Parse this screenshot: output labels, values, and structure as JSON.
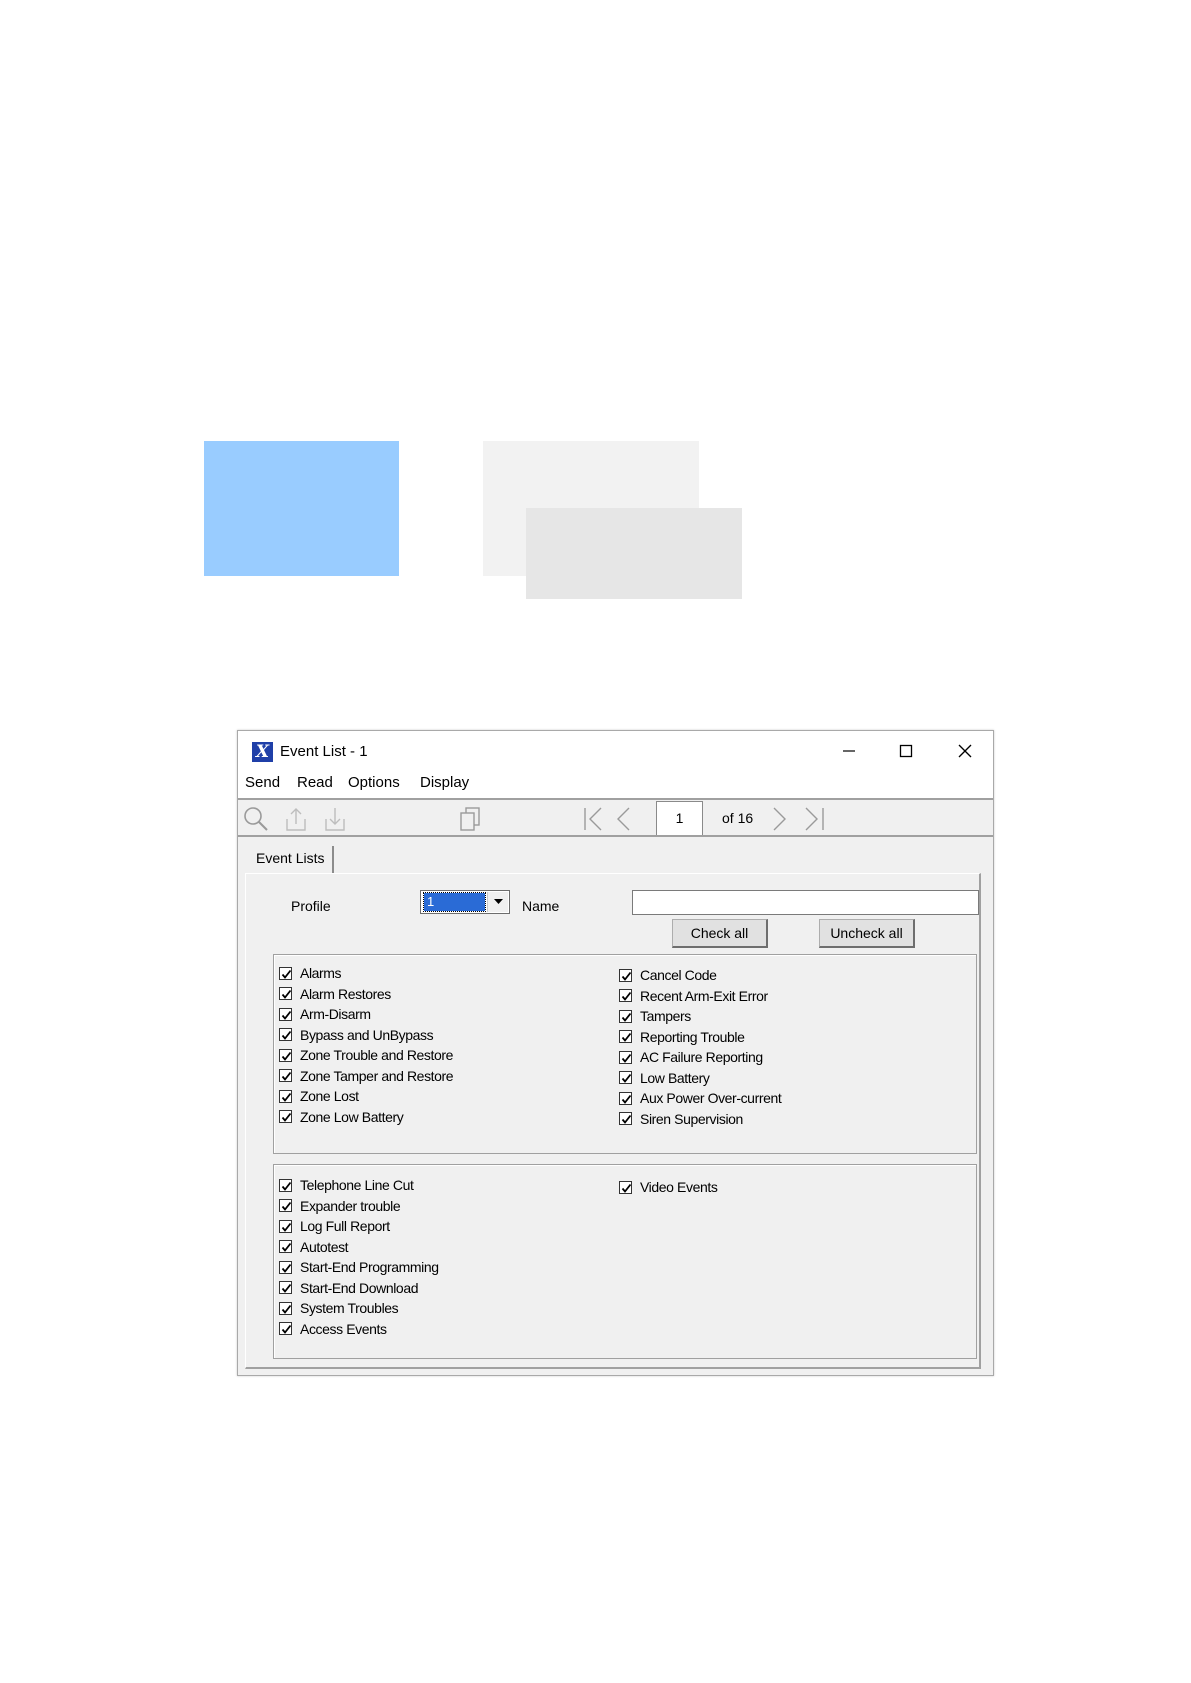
{
  "window": {
    "title": "Event List - 1",
    "icon": "app-x-icon",
    "controls": [
      "minimize-icon",
      "maximize-icon",
      "close-icon"
    ]
  },
  "menu": [
    "Send",
    "Read",
    "Options",
    "Display"
  ],
  "toolbar": {
    "icons": [
      "search-icon",
      "upload-icon",
      "download-icon",
      "copy-icon",
      "first-page-icon",
      "prev-page-icon",
      "next-page-icon",
      "last-page-icon"
    ],
    "page": "1",
    "page_of": "of 16"
  },
  "tab": "Event Lists",
  "form": {
    "profile_label": "Profile",
    "profile_value": "1",
    "name_label": "Name",
    "name_value": "",
    "check_all": "Check all",
    "uncheck_all": "Uncheck all"
  },
  "groups": [
    {
      "left": [
        {
          "label": "Alarms",
          "checked": true
        },
        {
          "label": "Alarm Restores",
          "checked": true
        },
        {
          "label": "Arm-Disarm",
          "checked": true
        },
        {
          "label": "Bypass and UnBypass",
          "checked": true
        },
        {
          "label": "Zone Trouble and Restore",
          "checked": true
        },
        {
          "label": "Zone Tamper and Restore",
          "checked": true
        },
        {
          "label": "Zone Lost",
          "checked": true
        },
        {
          "label": "Zone Low Battery",
          "checked": true
        }
      ],
      "right": [
        {
          "label": "Cancel Code",
          "checked": true
        },
        {
          "label": "Recent Arm-Exit Error",
          "checked": true
        },
        {
          "label": "Tampers",
          "checked": true
        },
        {
          "label": "Reporting Trouble",
          "checked": true
        },
        {
          "label": "AC Failure Reporting",
          "checked": true
        },
        {
          "label": "Low Battery",
          "checked": true
        },
        {
          "label": "Aux Power Over-current",
          "checked": true
        },
        {
          "label": "Siren Supervision",
          "checked": true
        }
      ]
    },
    {
      "left": [
        {
          "label": "Telephone Line Cut",
          "checked": true
        },
        {
          "label": "Expander trouble",
          "checked": true
        },
        {
          "label": "Log Full Report",
          "checked": true
        },
        {
          "label": "Autotest",
          "checked": true
        },
        {
          "label": "Start-End Programming",
          "checked": true
        },
        {
          "label": "Start-End Download",
          "checked": true
        },
        {
          "label": "System Troubles",
          "checked": true
        },
        {
          "label": "Access Events",
          "checked": true
        }
      ],
      "right": [
        {
          "label": "Video Events",
          "checked": true
        }
      ]
    }
  ],
  "colors": {
    "blue_block": "#99CCFF",
    "gray_block_back": "#F2F2F2",
    "gray_block_front": "#E6E6E6",
    "selection": "#2A6BD6",
    "panel_bg": "#F0F0F0"
  }
}
